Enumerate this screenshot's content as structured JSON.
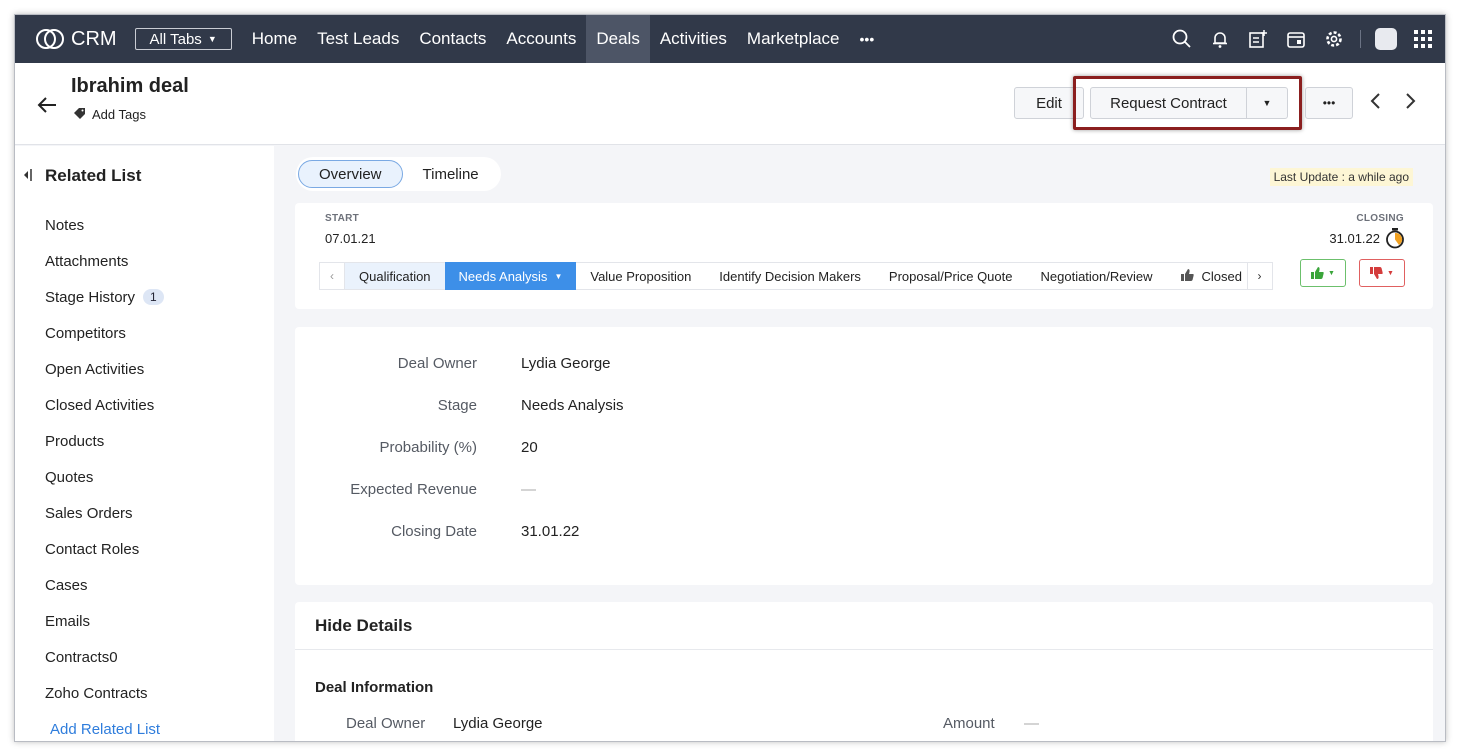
{
  "nav": {
    "app_name": "CRM",
    "all_tabs": "All Tabs",
    "items": [
      "Home",
      "Test Leads",
      "Contacts",
      "Accounts",
      "Deals",
      "Activities",
      "Marketplace"
    ],
    "more": "•••",
    "active": "Deals",
    "icons": [
      "search-icon",
      "bell-icon",
      "add-entry-icon",
      "calendar-icon",
      "gear-icon",
      "avatar",
      "apps-grid-icon"
    ]
  },
  "header": {
    "record_name": "Ibrahim deal",
    "add_tags": "Add Tags",
    "edit": "Edit",
    "request_contract": "Request Contract",
    "more": "•••"
  },
  "sidebar": {
    "title": "Related List",
    "items": [
      {
        "label": "Notes"
      },
      {
        "label": "Attachments"
      },
      {
        "label": "Stage History",
        "badge": "1"
      },
      {
        "label": "Competitors"
      },
      {
        "label": "Open Activities"
      },
      {
        "label": "Closed Activities"
      },
      {
        "label": "Products"
      },
      {
        "label": "Quotes"
      },
      {
        "label": "Sales Orders"
      },
      {
        "label": "Contact Roles"
      },
      {
        "label": "Cases"
      },
      {
        "label": "Emails"
      },
      {
        "label": "Contracts0"
      },
      {
        "label": "Zoho Contracts"
      }
    ],
    "add_link": "Add Related List"
  },
  "tabs": {
    "overview": "Overview",
    "timeline": "Timeline",
    "active": "Overview"
  },
  "last_update": "Last Update : a while ago",
  "stage": {
    "start_label": "START",
    "start_date": "07.01.21",
    "closing_label": "CLOSING",
    "closing_date": "31.01.22",
    "stages": [
      "Qualification",
      "Needs Analysis",
      "Value Proposition",
      "Identify Decision Makers",
      "Proposal/Price Quote",
      "Negotiation/Review",
      "Closed"
    ],
    "current": "Needs Analysis"
  },
  "overview": {
    "fields": [
      {
        "label": "Deal Owner",
        "value": "Lydia George"
      },
      {
        "label": "Stage",
        "value": "Needs Analysis"
      },
      {
        "label": "Probability (%)",
        "value": "20"
      },
      {
        "label": "Expected Revenue",
        "value": "—"
      },
      {
        "label": "Closing Date",
        "value": "31.01.22"
      }
    ]
  },
  "details": {
    "title": "Hide Details",
    "section": "Deal Information",
    "owner_label": "Deal Owner",
    "owner_value": "Lydia George",
    "amount_label": "Amount",
    "amount_value": "—"
  },
  "colors": {
    "nav_bg": "#313949",
    "accent": "#3d8fe8",
    "highlight_border": "#8b1f1f"
  }
}
